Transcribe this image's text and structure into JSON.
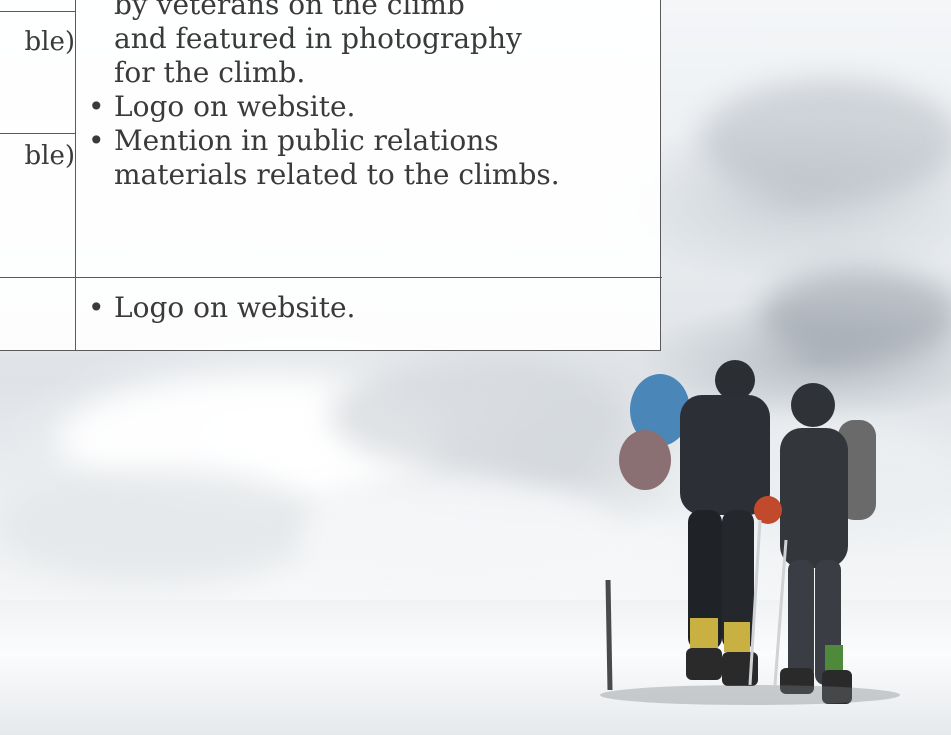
{
  "table": {
    "left_column": [
      {
        "id": "row1",
        "text": "ble)"
      },
      {
        "id": "row2",
        "text": "ble)"
      }
    ],
    "right_column": {
      "block1": {
        "continuation_lines": [
          "by veterans on the climb",
          "and featured in photography",
          "for the climb."
        ],
        "bullets": [
          {
            "bullet": "•",
            "lines": [
              "Logo on website."
            ]
          },
          {
            "bullet": "•",
            "lines": [
              "Mention in public relations",
              "materials related to the climbs."
            ]
          }
        ]
      },
      "block2": {
        "bullets": [
          {
            "bullet": "•",
            "lines": [
              "Logo on website."
            ]
          }
        ]
      }
    }
  },
  "colors": {
    "text": "#3a3a3a",
    "rule": "#5a5a5a",
    "table_background": "#ffffff"
  }
}
